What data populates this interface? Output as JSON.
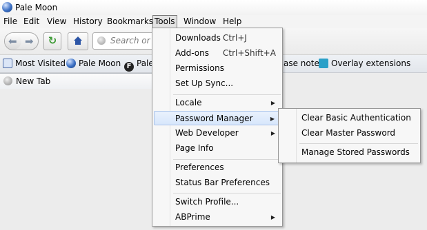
{
  "window": {
    "title": "Pale Moon"
  },
  "menubar": [
    {
      "label": "File",
      "underline": "F"
    },
    {
      "label": "Edit",
      "underline": "E"
    },
    {
      "label": "View",
      "underline": "V"
    },
    {
      "label": "History",
      "underline": "s"
    },
    {
      "label": "Bookmarks",
      "underline": "B"
    },
    {
      "label": "Tools",
      "underline": "T",
      "open": true
    },
    {
      "label": "Window",
      "underline": "W"
    },
    {
      "label": "Help",
      "underline": "H"
    }
  ],
  "navbar": {
    "search_placeholder": "Search or e"
  },
  "bookmarks": [
    {
      "label": "Most Visited",
      "icon": "search-icon"
    },
    {
      "label": "Pale Moon",
      "icon": "globe-icon"
    },
    {
      "label": "Pale",
      "icon": "f-icon"
    },
    {
      "label": "ase notes",
      "icon": "none"
    },
    {
      "label": "Overlay extensions",
      "icon": "overlay-icon"
    }
  ],
  "tabs": [
    {
      "label": "New Tab"
    }
  ],
  "tools_menu": {
    "items": [
      {
        "label": "Downloads",
        "shortcut": "Ctrl+J"
      },
      {
        "label": "Add-ons",
        "shortcut": "Ctrl+Shift+A"
      },
      {
        "label": "Permissions",
        "shortcut": ""
      },
      {
        "label": "Set Up Sync...",
        "shortcut": ""
      },
      {
        "label": "Locale",
        "shortcut": "",
        "submenu": true
      },
      {
        "label": "Password Manager",
        "shortcut": "",
        "submenu": true,
        "active": true
      },
      {
        "label": "Web Developer",
        "shortcut": "",
        "submenu": true
      },
      {
        "label": "Page Info",
        "shortcut": ""
      },
      {
        "label": "Preferences",
        "shortcut": ""
      },
      {
        "label": "Status Bar Preferences",
        "shortcut": ""
      },
      {
        "label": "Switch Profile...",
        "shortcut": ""
      },
      {
        "label": "ABPrime",
        "shortcut": "",
        "submenu": true
      }
    ]
  },
  "password_submenu": {
    "items": [
      {
        "label": "Clear Basic Authentication"
      },
      {
        "label": "Clear Master Password"
      },
      {
        "label": "Manage Stored Passwords"
      }
    ]
  }
}
